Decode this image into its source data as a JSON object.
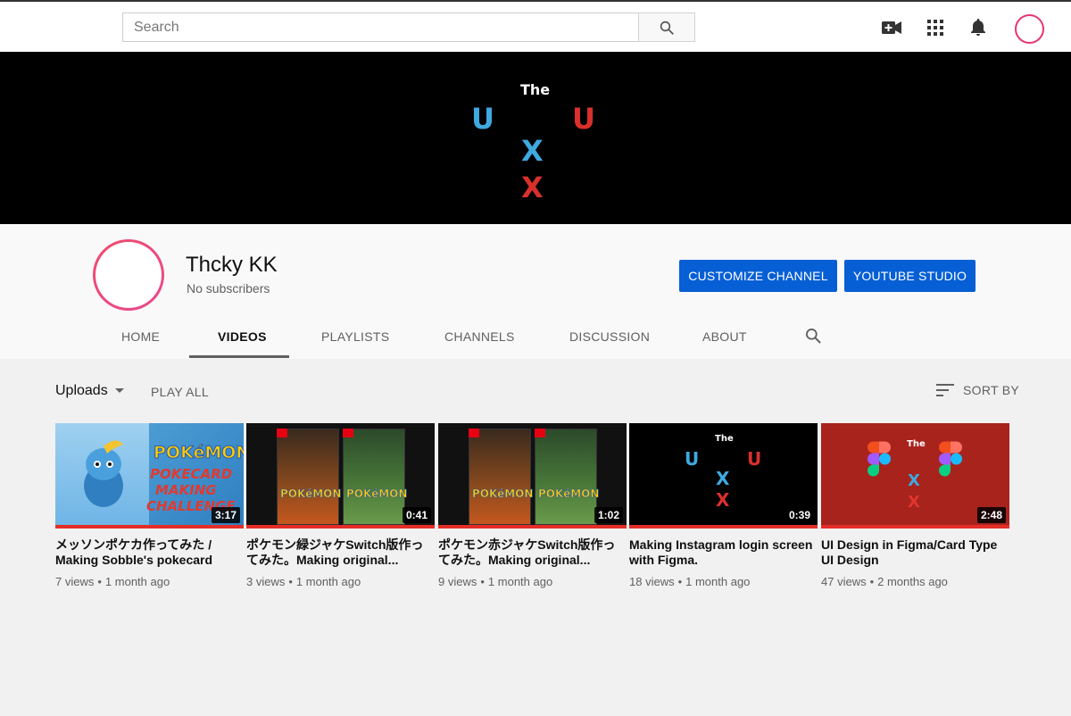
{
  "topbar": {
    "search_placeholder": "Search",
    "icons": [
      "search-icon",
      "create-video-icon",
      "apps-grid-icon",
      "notifications-bell-icon"
    ]
  },
  "banner": {
    "logo_the": "The",
    "logo_u_left": "U",
    "logo_u_right": "U",
    "logo_x_mid": "X",
    "logo_x_bottom": "X",
    "colors": {
      "blue": "#3fa9e0",
      "red": "#d9302c"
    }
  },
  "channel": {
    "name": "Thcky KK",
    "subscribers": "No subscribers",
    "customize_label": "CUSTOMIZE CHANNEL",
    "studio_label": "YOUTUBE STUDIO"
  },
  "tabs": [
    {
      "label": "HOME",
      "active": false
    },
    {
      "label": "VIDEOS",
      "active": true
    },
    {
      "label": "PLAYLISTS",
      "active": false
    },
    {
      "label": "CHANNELS",
      "active": false
    },
    {
      "label": "DISCUSSION",
      "active": false
    },
    {
      "label": "ABOUT",
      "active": false
    }
  ],
  "toolbar": {
    "uploads_label": "Uploads",
    "play_all_label": "PLAY ALL",
    "sort_label": "SORT BY"
  },
  "videos": [
    {
      "title": "メッソンポケカ作ってみた / Making Sobble's pokecard",
      "views": "7 views",
      "age": "1 month ago",
      "duration": "3:17",
      "thumb_text_1": "POKéMON",
      "thumb_text_2": "POKECARD",
      "thumb_text_3": "MAKING",
      "thumb_text_4": "CHALLENGE"
    },
    {
      "title": "ポケモン緑ジャケSwitch版作ってみた。Making original...",
      "views": "3 views",
      "age": "1 month ago",
      "duration": "0:41",
      "thumb_text_1": "POKéMON",
      "thumb_text_2": "POKéMON"
    },
    {
      "title": "ポケモン赤ジャケSwitch版作ってみた。Making original...",
      "views": "9 views",
      "age": "1 month ago",
      "duration": "1:02",
      "thumb_text_1": "POKéMON",
      "thumb_text_2": "POKéMON"
    },
    {
      "title": "Making Instagram login screen with Figma.",
      "views": "18 views",
      "age": "1 month ago",
      "duration": "0:39",
      "thumb_text_1": "The",
      "thumb_text_2": "U",
      "thumb_text_3": "U",
      "thumb_text_4": "X",
      "thumb_text_5": "X"
    },
    {
      "title": "UI Design in Figma/Card Type UI Design",
      "views": "47 views",
      "age": "2 months ago",
      "duration": "2:48",
      "thumb_text_1": "The",
      "thumb_text_2": "X",
      "thumb_text_3": "X"
    }
  ],
  "meta_separator": "•"
}
